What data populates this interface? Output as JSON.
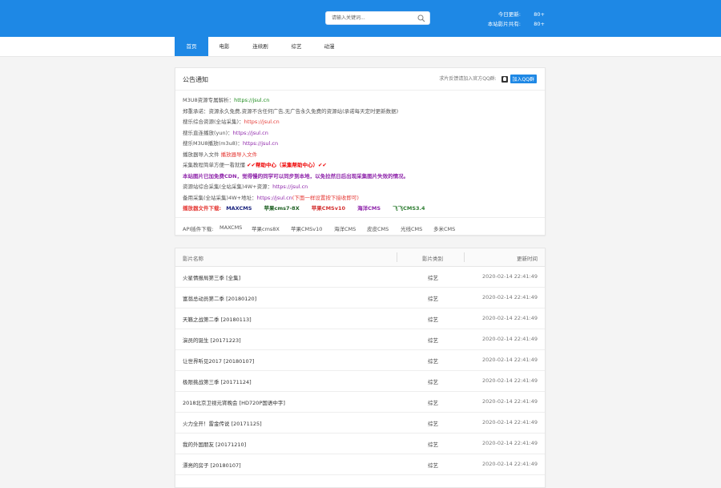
{
  "header": {
    "search_placeholder": "请输入关键词...",
    "stats": [
      {
        "label": "今日更新:",
        "value": "80+"
      },
      {
        "label": "本站影片共有:",
        "value": "80+"
      }
    ]
  },
  "nav": {
    "items": [
      "首页",
      "电影",
      "连续剧",
      "综艺",
      "动漫"
    ]
  },
  "notice": {
    "title": "公告通知",
    "qq_text": "求片反馈请加入官方QQ群:",
    "qq_button": "加入QQ群",
    "lines": {
      "l1_label": "M3U8资源专属解析：",
      "l1_link": "https://jsul.cn",
      "l2_text": "郑重承诺：资源永久免费,资源不含任何广告,无广告永久免费的资源站(承诺每天定时更新数据)",
      "l3_label": "搜乐综合资源(全站采集)：",
      "l3_link": "https://jsul.cn",
      "l4_label": "搜乐直连播放(yun)：",
      "l4_link": "https://jsul.cn",
      "l5_label": "搜乐M3U8播放(m3u8)：",
      "l5_link": "https://jsul.cn",
      "l6_label": "播放器导入文件",
      "l6_link": "播放器导入文件",
      "l7_label": "采集教程简单方便一看就懂",
      "l7_link": "✔✔帮助中心（采集帮助中心）✔✔",
      "l8_text": "本站图片已加免费CDN，觉得慢的同学可以同步到本地，以免拉然日后出现采集图片失效的情况。",
      "l9_label": "资源站综合采集(全站采集)4W+资源：",
      "l9_link": "https://jsul.cn",
      "l10_label": "备用采集(全站采集)4W+地址：",
      "l10_link": "https://jsul.cn",
      "l10_note": "(下面一样设置按下接收即可)",
      "dl_label": "播放器文件下载:",
      "dl_items": [
        "MAXCMS",
        "苹果cms7-8X",
        "苹果CMSv10",
        "海洋CMS",
        "飞飞CMS3.4"
      ]
    },
    "api_label": "API插件下载:",
    "api_items": [
      "MAXCMS",
      "苹果cms8X",
      "苹果CMSv10",
      "海洋CMS",
      "皮皮CMS",
      "光线CMS",
      "多米CMS"
    ]
  },
  "table": {
    "headers": [
      "影片名称",
      "影片类别",
      "更新时间"
    ],
    "rows": [
      {
        "name": "火星情报局第三季 [全集]",
        "category": "综艺",
        "time": "2020-02-14 22:41:49"
      },
      {
        "name": "富翁总动员第二季 [20180120]",
        "category": "综艺",
        "time": "2020-02-14 22:41:49"
      },
      {
        "name": "天籁之战第二季 [20180113]",
        "category": "综艺",
        "time": "2020-02-14 22:41:49"
      },
      {
        "name": "演员的诞生 [20171223]",
        "category": "综艺",
        "time": "2020-02-14 22:41:49"
      },
      {
        "name": "让世界听见2017 [20180107]",
        "category": "综艺",
        "time": "2020-02-14 22:41:49"
      },
      {
        "name": "极限挑战第三季 [20171124]",
        "category": "综艺",
        "time": "2020-02-14 22:41:49"
      },
      {
        "name": "2018北京卫视元宵晚会 [HD720P国语中字]",
        "category": "综艺",
        "time": "2020-02-14 22:41:49"
      },
      {
        "name": "火力全开！雷金传说 [20171125]",
        "category": "综艺",
        "time": "2020-02-14 22:41:49"
      },
      {
        "name": "我的外国朋友 [20171210]",
        "category": "综艺",
        "time": "2020-02-14 22:41:49"
      },
      {
        "name": "漂亮的房子 [20180107]",
        "category": "综艺",
        "time": "2020-02-14 22:41:49"
      }
    ]
  }
}
